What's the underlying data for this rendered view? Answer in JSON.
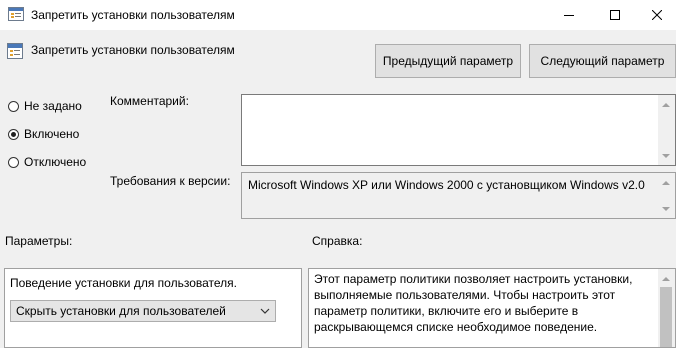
{
  "window": {
    "title": "Запретить установки пользователям"
  },
  "policy": {
    "name": "Запретить установки пользователям"
  },
  "nav": {
    "prev_label": "Предыдущий параметр",
    "next_label": "Следующий параметр"
  },
  "state_options": [
    {
      "label": "Не задано",
      "selected": false
    },
    {
      "label": "Включено",
      "selected": true
    },
    {
      "label": "Отключено",
      "selected": false
    }
  ],
  "comment": {
    "label": "Комментарий:",
    "value": ""
  },
  "requirements": {
    "label": "Требования к версии:",
    "value": "Microsoft Windows XP или Windows 2000 с установщиком Windows v2.0"
  },
  "options": {
    "header": "Параметры:",
    "behavior_label": "Поведение установки для пользователя.",
    "behavior_selected": "Скрыть установки для пользователей"
  },
  "help": {
    "header": "Справка:",
    "lines": [
      "Этот параметр политики позволяет настроить установки,",
      "выполняемые пользователями. Чтобы настроить этот",
      "параметр политики, включите его и выберите в",
      "раскрывающемся списке необходимое поведение."
    ]
  },
  "icons": {
    "app": "policy-window-icon",
    "policy": "policy-setting-icon",
    "minimize": "minimize-icon",
    "maximize": "maximize-icon",
    "close": "close-icon"
  }
}
